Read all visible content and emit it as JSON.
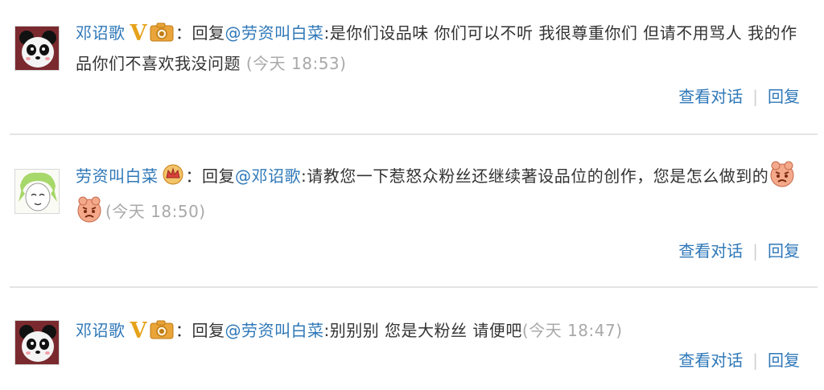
{
  "comments": [
    {
      "username": "邓诏歌",
      "reply_prefix": "：回复",
      "mention": "@劳资叫白菜",
      "text": ":是你们设品味 你们可以不听 我很尊重你们 但请不用骂人 我的作品你们不喜欢我没问题",
      "time": "(今天 18:53)",
      "actions": {
        "view_conversation": "查看对话",
        "separator": "|",
        "reply": "回复"
      }
    },
    {
      "username": "劳资叫白菜",
      "reply_prefix": "：回复",
      "mention": "@邓诏歌",
      "text": ":请教您一下惹怒众粉丝还继续著设品位的创作，您是怎么做到的",
      "time": "(今天 18:50)",
      "actions": {
        "view_conversation": "查看对话",
        "separator": "|",
        "reply": "回复"
      }
    },
    {
      "username": "邓诏歌",
      "reply_prefix": "：回复",
      "mention": "@劳资叫白菜",
      "text": ":别别别 您是大粉丝 请便吧",
      "time": "(今天 18:47)",
      "actions": {
        "view_conversation": "查看对话",
        "separator": "|",
        "reply": "回复"
      }
    }
  ],
  "colors": {
    "link": "#2f78b8",
    "text": "#333333",
    "time": "#a9a9a9",
    "verified_badge": "#e6a21a",
    "divider": "#e4e4e4"
  },
  "icons": {
    "verified": "verified-v-icon",
    "camera_badge": "camera-badge-icon",
    "crown_badge": "crown-badge-icon",
    "emoji": "angry-emoji-icon"
  }
}
